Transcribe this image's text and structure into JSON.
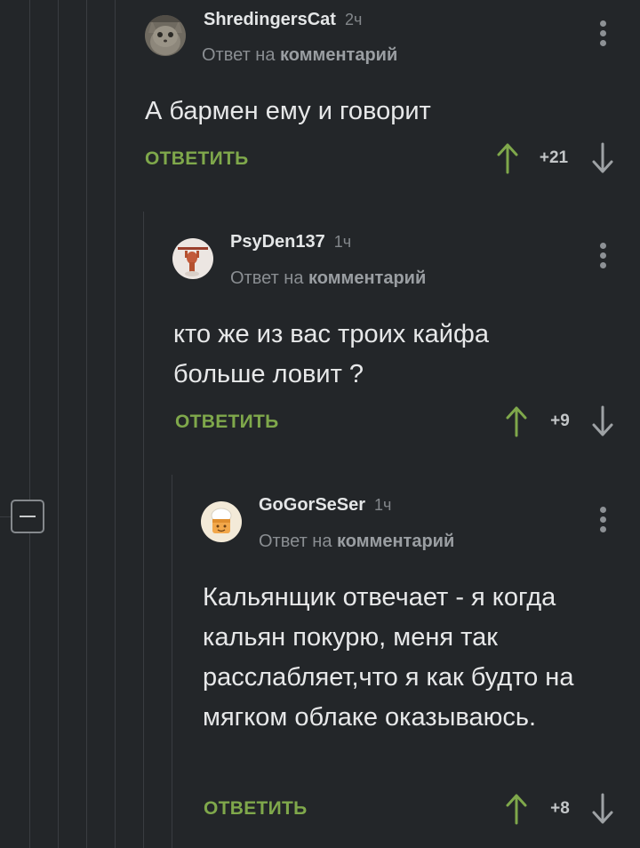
{
  "comments": [
    {
      "author": "ShredingersCat",
      "time": "2ч",
      "reply_prefix": "Ответ на",
      "reply_target": "комментарий",
      "text": "А бармен ему и говорит",
      "reply_label": "ОТВЕТИТЬ",
      "rating": "+21",
      "avatar": "cat-avatar"
    },
    {
      "author": "PsyDen137",
      "time": "1ч",
      "reply_prefix": "Ответ на",
      "reply_target": "комментарий",
      "text": "кто же из вас троих кайфа больше ловит ?",
      "reply_label": "ОТВЕТИТЬ",
      "rating": "+9",
      "avatar": "figure-avatar"
    },
    {
      "author": "GoGorSeSer",
      "time": "1ч",
      "reply_prefix": "Ответ на",
      "reply_target": "комментарий",
      "text": "Кальянщик отвечает - я когда кальян покурю, меня так расслабляет,что я как будто на мягком облаке оказываюсь.",
      "reply_label": "ОТВЕТИТЬ",
      "rating": "+8",
      "avatar": "chef-avatar"
    }
  ],
  "colors": {
    "background": "#232629",
    "reply_green": "#7fa84b",
    "upvote_green": "#7fa84b",
    "downvote_gray": "#9ea2a5",
    "thread_line": "#3a3d41"
  },
  "icons": {
    "collapse": "minus-square-icon",
    "menu": "vertical-dots-icon",
    "upvote": "arrow-up-icon",
    "downvote": "arrow-down-icon"
  }
}
